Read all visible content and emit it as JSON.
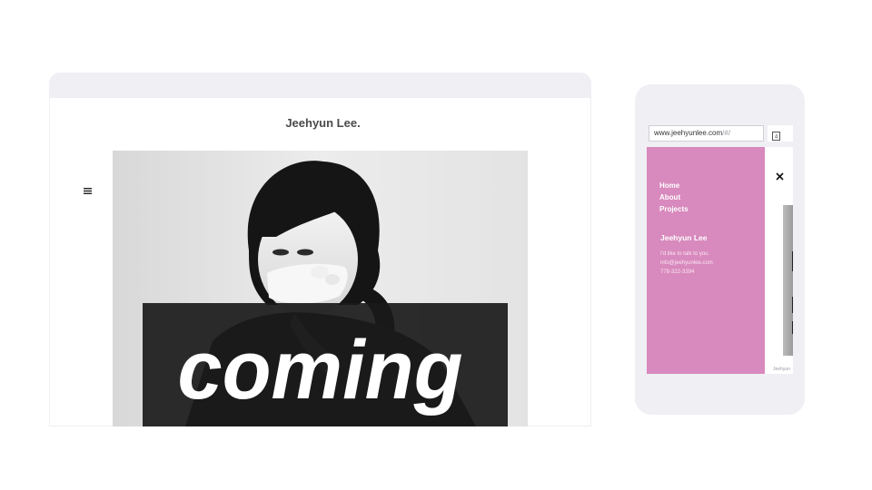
{
  "desktop": {
    "site_title": "Jeehyun Lee.",
    "menu_icon": "hamburger-icon",
    "hero": {
      "image": "portrait-photo-woman-covering-mouth",
      "overlay_word": "coming",
      "overlay_color": "#1a1a1a"
    }
  },
  "mobile": {
    "url": {
      "domain": "www.jeehyunlee.com",
      "path": "/#/"
    },
    "tab_icon": "tab-switcher-icon",
    "close_icon": "close-icon",
    "menu": {
      "background": "#d889bd",
      "nav": [
        "Home",
        "About",
        "Projects"
      ],
      "name": "Jeehyun Lee",
      "contact": [
        "I'd like to talk to you.",
        "info@jeehyunlee.com",
        "778-322-3394"
      ]
    },
    "peek_caption": "Jeehyun"
  },
  "colors": {
    "chrome": "#efeff4",
    "title_text": "#4a4a4a",
    "accent_pink": "#d889bd"
  }
}
